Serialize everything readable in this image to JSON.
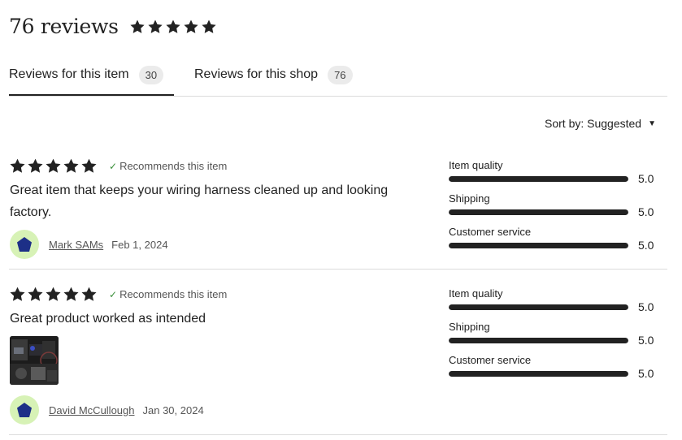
{
  "header": {
    "title": "76 reviews",
    "rating": 5
  },
  "tabs": [
    {
      "label": "Reviews for this item",
      "count": "30"
    },
    {
      "label": "Reviews for this shop",
      "count": "76"
    }
  ],
  "sort": {
    "label": "Sort by: Suggested"
  },
  "reviews": [
    {
      "stars": 5,
      "recommends": "Recommends this item",
      "text": "Great item that keeps your wiring harness cleaned up and looking factory.",
      "name": "Mark SAMs",
      "date": "Feb 1, 2024",
      "ratings": [
        {
          "label": "Item quality",
          "value": "5.0",
          "fraction": 1.0
        },
        {
          "label": "Shipping",
          "value": "5.0",
          "fraction": 1.0
        },
        {
          "label": "Customer service",
          "value": "5.0",
          "fraction": 1.0
        }
      ]
    },
    {
      "stars": 5,
      "recommends": "Recommends this item",
      "text": "Great product worked as intended",
      "name": "David McCullough",
      "date": "Jan 30, 2024",
      "ratings": [
        {
          "label": "Item quality",
          "value": "5.0",
          "fraction": 1.0
        },
        {
          "label": "Shipping",
          "value": "5.0",
          "fraction": 1.0
        },
        {
          "label": "Customer service",
          "value": "5.0",
          "fraction": 1.0
        }
      ]
    }
  ],
  "colors": {
    "star": "#222222",
    "avatar_bg": "#d7f2b6",
    "avatar_icon": "#1d2f87",
    "bar": "#222222",
    "check": "#3a8f3a"
  }
}
